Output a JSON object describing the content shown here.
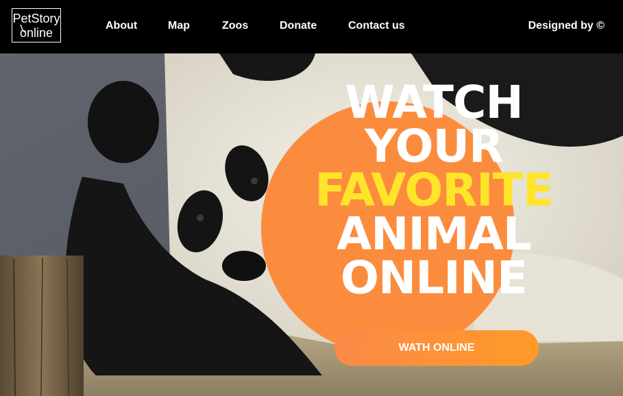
{
  "header": {
    "logo": {
      "line1": "PetStory",
      "line2": "online"
    },
    "nav": [
      {
        "label": "About"
      },
      {
        "label": "Map"
      },
      {
        "label": "Zoos"
      },
      {
        "label": "Donate"
      },
      {
        "label": "Contact us"
      }
    ],
    "credit": "Designed by ©"
  },
  "hero": {
    "headline": {
      "line1": "WATCH",
      "line2": "YOUR",
      "line3": "FAVORITE",
      "line4": "ANIMAL",
      "line5": "ONLINE"
    },
    "cta_label": "WATH ONLINE"
  },
  "colors": {
    "header_bg": "#000000",
    "circle": "#fb8c3e",
    "accent_text": "#ffe52a",
    "cta_start": "#fb8a48",
    "cta_end": "#ff9a28"
  }
}
